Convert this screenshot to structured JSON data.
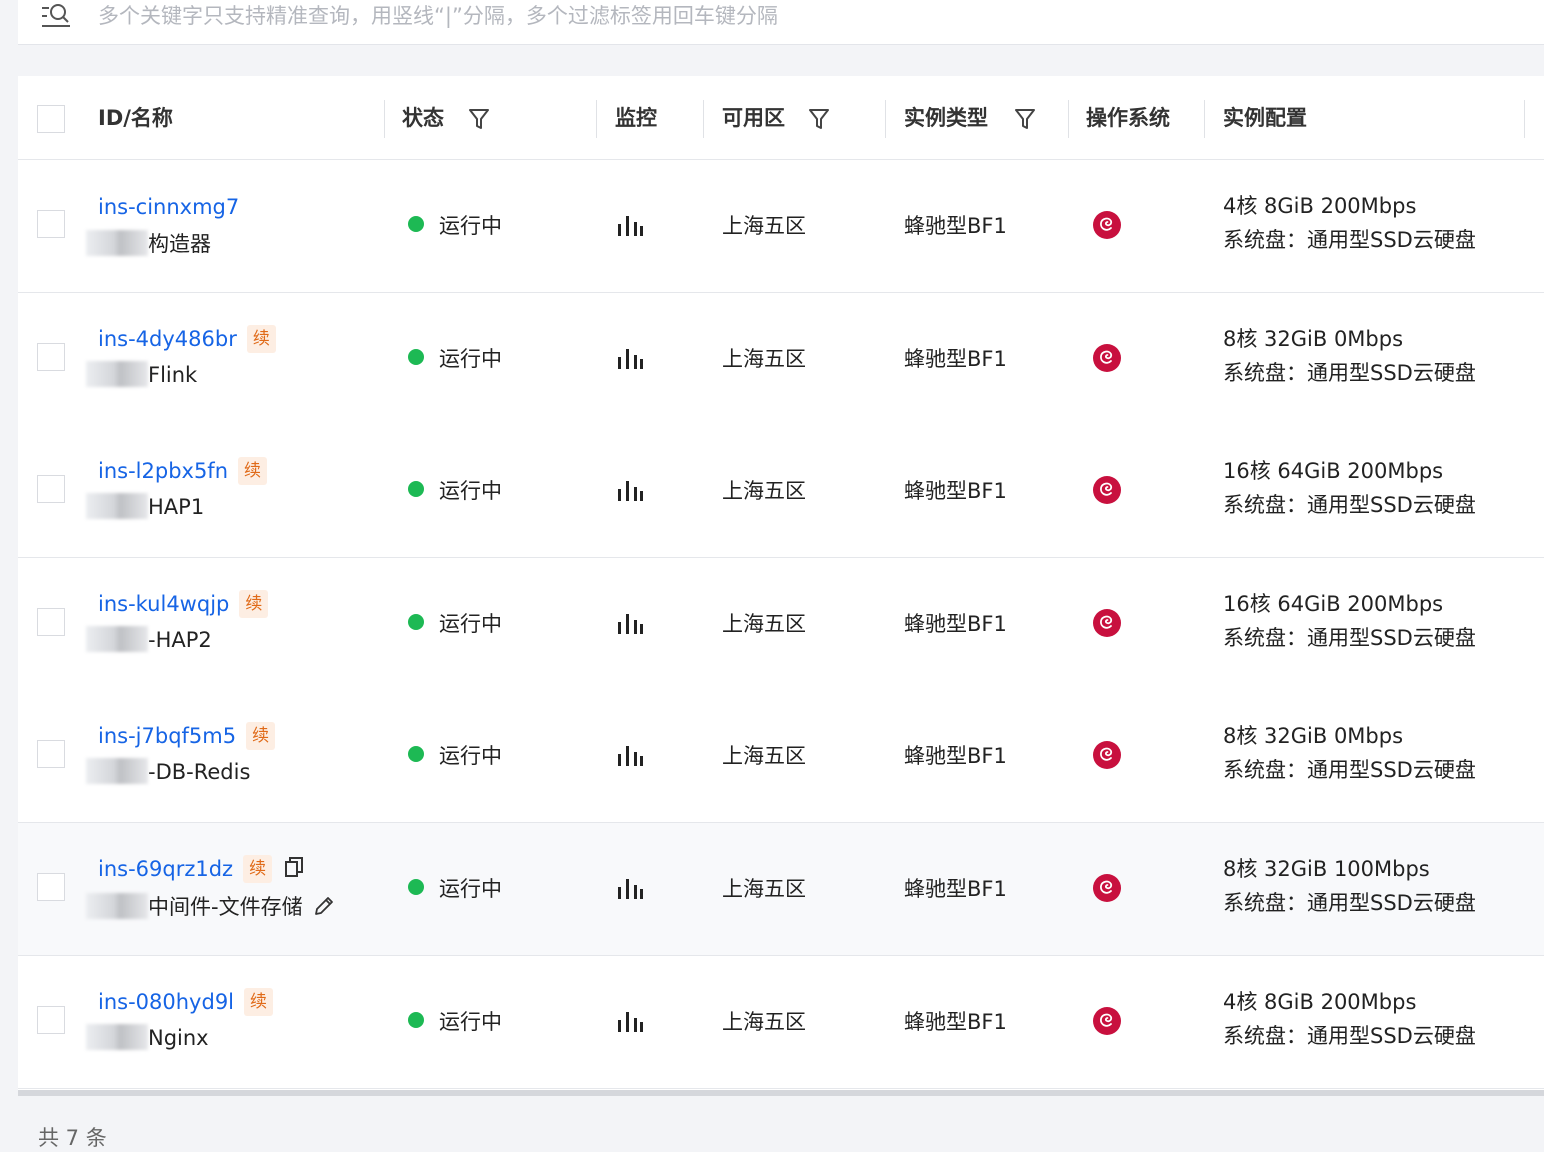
{
  "search": {
    "placeholder": "多个关键字只支持精准查询，用竖线“|”分隔，多个过滤标签用回车键分隔"
  },
  "columns": {
    "id_name": "ID/名称",
    "status": "状态",
    "monitor": "监控",
    "zone": "可用区",
    "instance_type": "实例类型",
    "os": "操作系统",
    "config": "实例配置"
  },
  "renew_label": "续",
  "rows": [
    {
      "id": "ins-cinnxmg7",
      "name": "构造器",
      "renew": false,
      "status": "运行中",
      "zone": "上海五区",
      "type": "蜂驰型BF1",
      "config": "4核 8GiB 200Mbps",
      "disk": "系统盘：通用型SSD云硬盘"
    },
    {
      "id": "ins-4dy486br",
      "name": "Flink",
      "renew": true,
      "status": "运行中",
      "zone": "上海五区",
      "type": "蜂驰型BF1",
      "config": "8核 32GiB 0Mbps",
      "disk": "系统盘：通用型SSD云硬盘"
    },
    {
      "id": "ins-l2pbx5fn",
      "name": "HAP1",
      "renew": true,
      "status": "运行中",
      "zone": "上海五区",
      "type": "蜂驰型BF1",
      "config": "16核 64GiB 200Mbps",
      "disk": "系统盘：通用型SSD云硬盘"
    },
    {
      "id": "ins-kul4wqjp",
      "name": "-HAP2",
      "renew": true,
      "status": "运行中",
      "zone": "上海五区",
      "type": "蜂驰型BF1",
      "config": "16核 64GiB 200Mbps",
      "disk": "系统盘：通用型SSD云硬盘"
    },
    {
      "id": "ins-j7bqf5m5",
      "name": "-DB-Redis",
      "renew": true,
      "status": "运行中",
      "zone": "上海五区",
      "type": "蜂驰型BF1",
      "config": "8核 32GiB 0Mbps",
      "disk": "系统盘：通用型SSD云硬盘"
    },
    {
      "id": "ins-69qrz1dz",
      "name": "中间件-文件存储",
      "renew": true,
      "status": "运行中",
      "zone": "上海五区",
      "type": "蜂驰型BF1",
      "config": "8核 32GiB 100Mbps",
      "disk": "系统盘：通用型SSD云硬盘"
    },
    {
      "id": "ins-080hyd9l",
      "name": "Nginx",
      "renew": true,
      "status": "运行中",
      "zone": "上海五区",
      "type": "蜂驰型BF1",
      "config": "4核 8GiB 200Mbps",
      "disk": "系统盘：通用型SSD云硬盘"
    }
  ],
  "footer": {
    "total": "共 7 条"
  },
  "colors": {
    "link": "#1664e5",
    "running": "#1db954",
    "renew_bg": "#fdeee3",
    "renew_text": "#e06a18",
    "debian": "#c8103e"
  },
  "icons": [
    "search-icon",
    "filter-icon",
    "monitor-icon",
    "debian-icon",
    "copy-icon",
    "edit-icon"
  ]
}
